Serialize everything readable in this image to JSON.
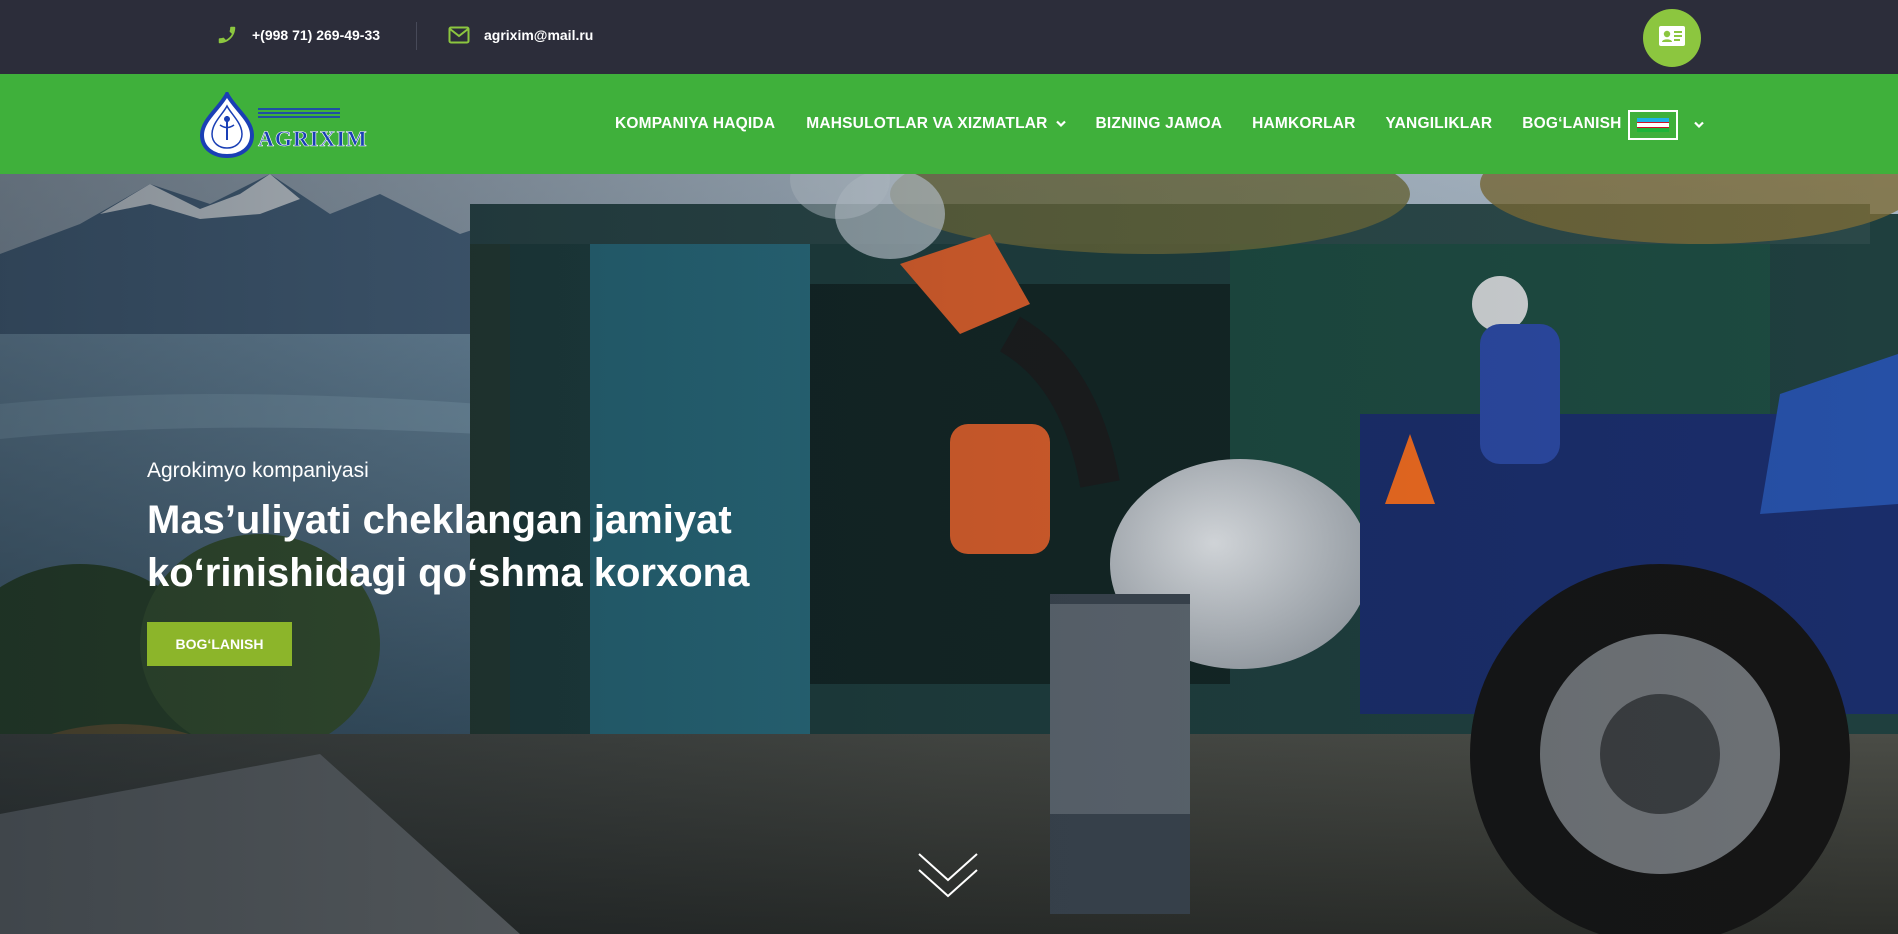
{
  "topbar": {
    "phone": "+(998 71) 269-49-33",
    "email": "agrixim@mail.ru",
    "phone_icon": "phone-icon",
    "email_icon": "envelope-icon",
    "card_icon": "contact-card-icon"
  },
  "navbar": {
    "logo_text": "AGRIXIM",
    "menu": [
      {
        "label": "KOMPANIYA HAQIDA"
      },
      {
        "label": "MAHSULOTLAR VA XIZMATLAR",
        "has_dropdown": true
      },
      {
        "label": "BIZNING JAMOA"
      },
      {
        "label": "HAMKORLAR"
      },
      {
        "label": "YANGILIKLAR"
      },
      {
        "label": "BOG‘LANISH"
      }
    ],
    "language_icon": "uzbekistan-flag-icon"
  },
  "hero": {
    "subtitle": "Agrokimyo kompaniyasi",
    "title_line1": "Mas’uliyati cheklangan jamiyat",
    "title_line2": "ko‘rinishidagi qo‘shma korxona",
    "cta_label": "BOG‘LANISH",
    "scroll_icon": "double-chevron-down-icon"
  },
  "colors": {
    "topbar_bg": "#2c2d3a",
    "navbar_bg": "#3fb03b",
    "accent": "#8cc63f",
    "cta_bg": "#8cb52a"
  }
}
